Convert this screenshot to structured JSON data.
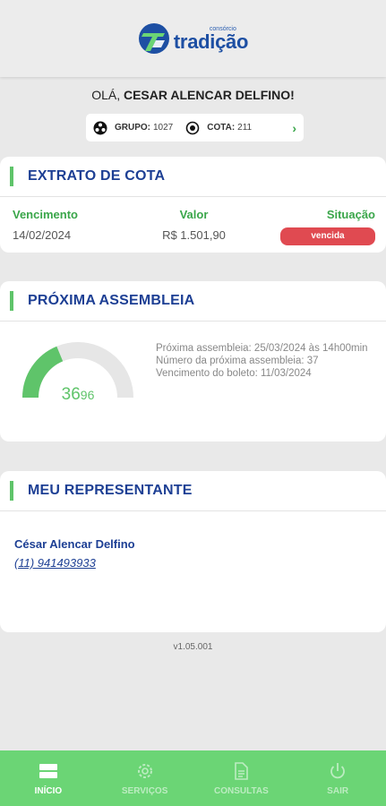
{
  "header": {
    "brand_small": "consórcio",
    "brand_name": "tradição"
  },
  "greeting": {
    "prefix": "OLÁ, ",
    "name": "CESAR ALENCAR DELFINO!"
  },
  "group": {
    "group_label": "GRUPO:",
    "group_value": "1027",
    "cota_label": "COTA:",
    "cota_value": "211"
  },
  "extrato": {
    "title": "EXTRATO DE COTA",
    "col_vencimento": "Vencimento",
    "col_valor": "Valor",
    "col_situacao": "Situação",
    "vencimento": "14/02/2024",
    "valor": "R$ 1.501,90",
    "situacao": "vencida",
    "situacao_color": "#e04a51"
  },
  "assembleia": {
    "title": "PRÓXIMA ASSEMBLEIA",
    "gauge_current": "36",
    "gauge_total": "96",
    "gauge_progress": 0.375,
    "line1": "Próxima assembleia: 25/03/2024 às 14h00min",
    "line2": "Número da próxima assembleia: 37",
    "line3": "Vencimento do boleto: 11/03/2024"
  },
  "representante": {
    "title": "MEU REPRESENTANTE",
    "name": "César Alencar Delfino",
    "phone": "(11) 941493933"
  },
  "version": "v1.05.001",
  "nav": {
    "inicio": "INÍCIO",
    "servicos": "SERVIÇOS",
    "consultas": "CONSULTAS",
    "sair": "SAIR"
  },
  "colors": {
    "accent_green": "#5fc46a",
    "nav_green": "#6bd575",
    "title_blue": "#1d3f94"
  }
}
